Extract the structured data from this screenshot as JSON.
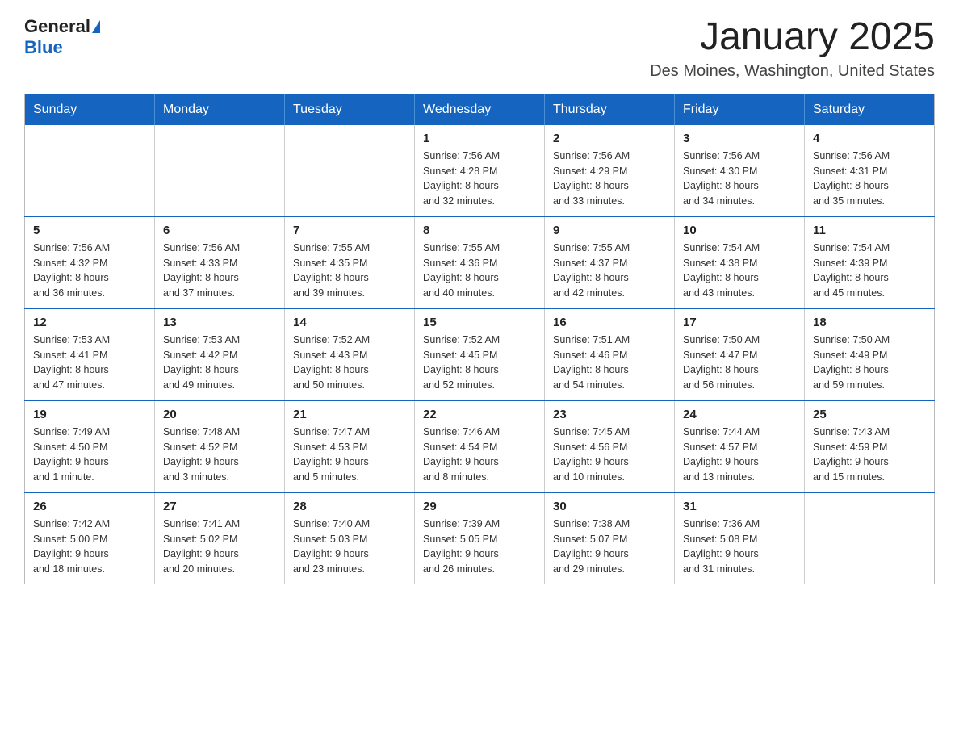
{
  "logo": {
    "general": "General",
    "blue": "Blue"
  },
  "header": {
    "month_title": "January 2025",
    "location": "Des Moines, Washington, United States"
  },
  "days_of_week": [
    "Sunday",
    "Monday",
    "Tuesday",
    "Wednesday",
    "Thursday",
    "Friday",
    "Saturday"
  ],
  "weeks": [
    [
      {
        "day": "",
        "info": ""
      },
      {
        "day": "",
        "info": ""
      },
      {
        "day": "",
        "info": ""
      },
      {
        "day": "1",
        "info": "Sunrise: 7:56 AM\nSunset: 4:28 PM\nDaylight: 8 hours\nand 32 minutes."
      },
      {
        "day": "2",
        "info": "Sunrise: 7:56 AM\nSunset: 4:29 PM\nDaylight: 8 hours\nand 33 minutes."
      },
      {
        "day": "3",
        "info": "Sunrise: 7:56 AM\nSunset: 4:30 PM\nDaylight: 8 hours\nand 34 minutes."
      },
      {
        "day": "4",
        "info": "Sunrise: 7:56 AM\nSunset: 4:31 PM\nDaylight: 8 hours\nand 35 minutes."
      }
    ],
    [
      {
        "day": "5",
        "info": "Sunrise: 7:56 AM\nSunset: 4:32 PM\nDaylight: 8 hours\nand 36 minutes."
      },
      {
        "day": "6",
        "info": "Sunrise: 7:56 AM\nSunset: 4:33 PM\nDaylight: 8 hours\nand 37 minutes."
      },
      {
        "day": "7",
        "info": "Sunrise: 7:55 AM\nSunset: 4:35 PM\nDaylight: 8 hours\nand 39 minutes."
      },
      {
        "day": "8",
        "info": "Sunrise: 7:55 AM\nSunset: 4:36 PM\nDaylight: 8 hours\nand 40 minutes."
      },
      {
        "day": "9",
        "info": "Sunrise: 7:55 AM\nSunset: 4:37 PM\nDaylight: 8 hours\nand 42 minutes."
      },
      {
        "day": "10",
        "info": "Sunrise: 7:54 AM\nSunset: 4:38 PM\nDaylight: 8 hours\nand 43 minutes."
      },
      {
        "day": "11",
        "info": "Sunrise: 7:54 AM\nSunset: 4:39 PM\nDaylight: 8 hours\nand 45 minutes."
      }
    ],
    [
      {
        "day": "12",
        "info": "Sunrise: 7:53 AM\nSunset: 4:41 PM\nDaylight: 8 hours\nand 47 minutes."
      },
      {
        "day": "13",
        "info": "Sunrise: 7:53 AM\nSunset: 4:42 PM\nDaylight: 8 hours\nand 49 minutes."
      },
      {
        "day": "14",
        "info": "Sunrise: 7:52 AM\nSunset: 4:43 PM\nDaylight: 8 hours\nand 50 minutes."
      },
      {
        "day": "15",
        "info": "Sunrise: 7:52 AM\nSunset: 4:45 PM\nDaylight: 8 hours\nand 52 minutes."
      },
      {
        "day": "16",
        "info": "Sunrise: 7:51 AM\nSunset: 4:46 PM\nDaylight: 8 hours\nand 54 minutes."
      },
      {
        "day": "17",
        "info": "Sunrise: 7:50 AM\nSunset: 4:47 PM\nDaylight: 8 hours\nand 56 minutes."
      },
      {
        "day": "18",
        "info": "Sunrise: 7:50 AM\nSunset: 4:49 PM\nDaylight: 8 hours\nand 59 minutes."
      }
    ],
    [
      {
        "day": "19",
        "info": "Sunrise: 7:49 AM\nSunset: 4:50 PM\nDaylight: 9 hours\nand 1 minute."
      },
      {
        "day": "20",
        "info": "Sunrise: 7:48 AM\nSunset: 4:52 PM\nDaylight: 9 hours\nand 3 minutes."
      },
      {
        "day": "21",
        "info": "Sunrise: 7:47 AM\nSunset: 4:53 PM\nDaylight: 9 hours\nand 5 minutes."
      },
      {
        "day": "22",
        "info": "Sunrise: 7:46 AM\nSunset: 4:54 PM\nDaylight: 9 hours\nand 8 minutes."
      },
      {
        "day": "23",
        "info": "Sunrise: 7:45 AM\nSunset: 4:56 PM\nDaylight: 9 hours\nand 10 minutes."
      },
      {
        "day": "24",
        "info": "Sunrise: 7:44 AM\nSunset: 4:57 PM\nDaylight: 9 hours\nand 13 minutes."
      },
      {
        "day": "25",
        "info": "Sunrise: 7:43 AM\nSunset: 4:59 PM\nDaylight: 9 hours\nand 15 minutes."
      }
    ],
    [
      {
        "day": "26",
        "info": "Sunrise: 7:42 AM\nSunset: 5:00 PM\nDaylight: 9 hours\nand 18 minutes."
      },
      {
        "day": "27",
        "info": "Sunrise: 7:41 AM\nSunset: 5:02 PM\nDaylight: 9 hours\nand 20 minutes."
      },
      {
        "day": "28",
        "info": "Sunrise: 7:40 AM\nSunset: 5:03 PM\nDaylight: 9 hours\nand 23 minutes."
      },
      {
        "day": "29",
        "info": "Sunrise: 7:39 AM\nSunset: 5:05 PM\nDaylight: 9 hours\nand 26 minutes."
      },
      {
        "day": "30",
        "info": "Sunrise: 7:38 AM\nSunset: 5:07 PM\nDaylight: 9 hours\nand 29 minutes."
      },
      {
        "day": "31",
        "info": "Sunrise: 7:36 AM\nSunset: 5:08 PM\nDaylight: 9 hours\nand 31 minutes."
      },
      {
        "day": "",
        "info": ""
      }
    ]
  ]
}
